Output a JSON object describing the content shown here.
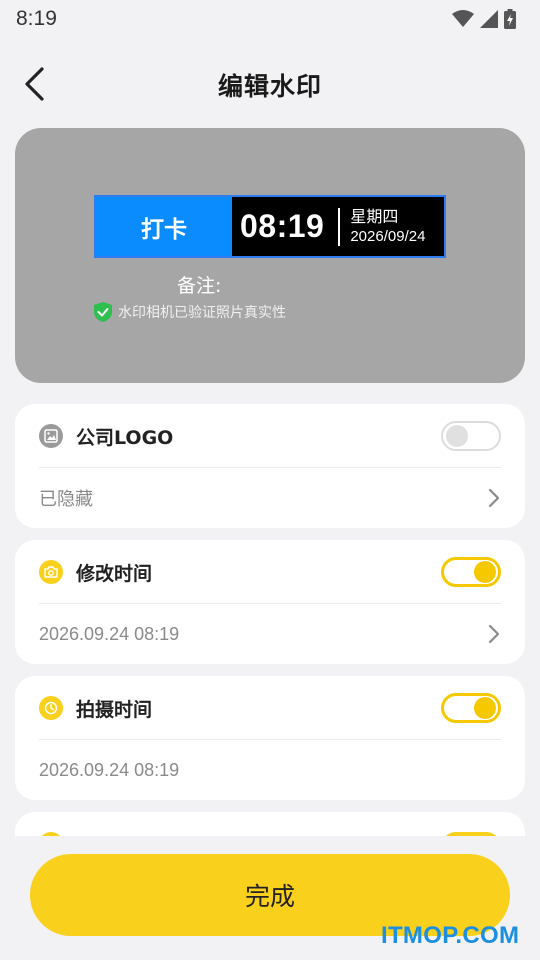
{
  "status_bar": {
    "time": "8:19"
  },
  "header": {
    "title": "编辑水印"
  },
  "preview": {
    "tag": "打卡",
    "time": "08:19",
    "weekday": "星期四",
    "date": "2026/09/24",
    "note": "备注:",
    "verified": "水印相机已验证照片真实性"
  },
  "cards": [
    {
      "title": "公司LOGO",
      "value": "已隐藏",
      "toggle_on": false
    },
    {
      "title": "修改时间",
      "value": "2026.09.24 08:19",
      "toggle_on": true
    },
    {
      "title": "拍摄时间",
      "value": "2026.09.24 08:19",
      "toggle_on": true
    }
  ],
  "footer": {
    "done_label": "完成"
  },
  "watermark_site": "ITMOP.COM",
  "colors": {
    "accent": "#f9d01c",
    "blue_tag": "#0a8cff",
    "toggle_on": "#f5c800"
  }
}
